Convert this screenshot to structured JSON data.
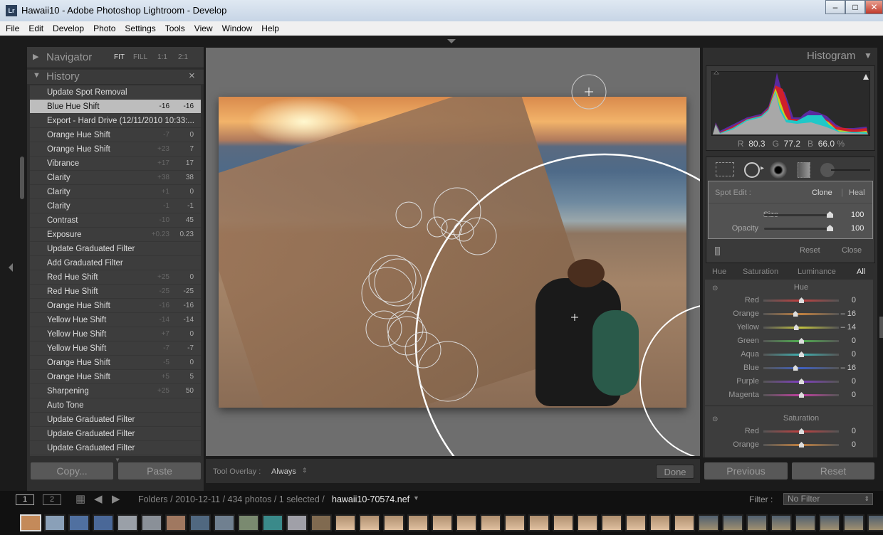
{
  "window": {
    "title": "Hawaii10 - Adobe Photoshop Lightroom - Develop",
    "app_icon": "Lr",
    "minimize": "–",
    "maximize": "□",
    "close": "✕"
  },
  "menu": [
    "File",
    "Edit",
    "Develop",
    "Photo",
    "Settings",
    "Tools",
    "View",
    "Window",
    "Help"
  ],
  "navigator": {
    "title": "Navigator",
    "zooms": [
      "FIT",
      "FILL",
      "1:1",
      "2:1"
    ]
  },
  "history": {
    "title": "History",
    "close": "×",
    "items": [
      {
        "label": "Update Spot Removal",
        "delta": "",
        "value": ""
      },
      {
        "label": "Blue Hue Shift",
        "delta": "-16",
        "value": "-16",
        "selected": true
      },
      {
        "label": "Export - Hard Drive (12/11/2010 10:33:...",
        "delta": "",
        "value": ""
      },
      {
        "label": "Orange Hue Shift",
        "delta": "-7",
        "value": "0"
      },
      {
        "label": "Orange Hue Shift",
        "delta": "+23",
        "value": "7"
      },
      {
        "label": "Vibrance",
        "delta": "+17",
        "value": "17"
      },
      {
        "label": "Clarity",
        "delta": "+38",
        "value": "38"
      },
      {
        "label": "Clarity",
        "delta": "+1",
        "value": "0"
      },
      {
        "label": "Clarity",
        "delta": "-1",
        "value": "-1"
      },
      {
        "label": "Contrast",
        "delta": "-10",
        "value": "45"
      },
      {
        "label": "Exposure",
        "delta": "+0.23",
        "value": "0.23"
      },
      {
        "label": "Update Graduated Filter",
        "delta": "",
        "value": ""
      },
      {
        "label": "Add Graduated Filter",
        "delta": "",
        "value": ""
      },
      {
        "label": "Red Hue Shift",
        "delta": "+25",
        "value": "0"
      },
      {
        "label": "Red Hue Shift",
        "delta": "-25",
        "value": "-25"
      },
      {
        "label": "Orange Hue Shift",
        "delta": "-16",
        "value": "-16"
      },
      {
        "label": "Yellow Hue Shift",
        "delta": "-14",
        "value": "-14"
      },
      {
        "label": "Yellow Hue Shift",
        "delta": "+7",
        "value": "0"
      },
      {
        "label": "Yellow Hue Shift",
        "delta": "-7",
        "value": "-7"
      },
      {
        "label": "Orange Hue Shift",
        "delta": "-5",
        "value": "0"
      },
      {
        "label": "Orange Hue Shift",
        "delta": "+5",
        "value": "5"
      },
      {
        "label": "Sharpening",
        "delta": "+25",
        "value": "50"
      },
      {
        "label": "Auto Tone",
        "delta": "",
        "value": ""
      },
      {
        "label": "Update Graduated Filter",
        "delta": "",
        "value": ""
      },
      {
        "label": "Update Graduated Filter",
        "delta": "",
        "value": ""
      },
      {
        "label": "Update Graduated Filter",
        "delta": "",
        "value": ""
      }
    ]
  },
  "left_buttons": {
    "copy": "Copy...",
    "paste": "Paste"
  },
  "toolbar": {
    "overlay_label": "Tool Overlay :",
    "overlay_value": "Always",
    "done": "Done"
  },
  "histogram": {
    "title": "Histogram",
    "r_label": "R",
    "r": "80.3",
    "g_label": "G",
    "g": "77.2",
    "b_label": "B",
    "b": "66.0",
    "unit": "%"
  },
  "spot": {
    "label": "Spot Edit :",
    "clone": "Clone",
    "heal": "Heal",
    "size_label": "Size",
    "size": "100",
    "size_level": 100,
    "opacity_label": "Opacity",
    "opacity": "100",
    "opacity_level": 100,
    "reset": "Reset",
    "close": "Close"
  },
  "hsl": {
    "tabs": [
      "Hue",
      "Saturation",
      "Luminance",
      "All"
    ],
    "active_tab": "All",
    "hue_title": "Hue",
    "hue": [
      {
        "label": "Red",
        "value": "0",
        "color": "#c04040"
      },
      {
        "label": "Orange",
        "value": "– 16",
        "color": "#c08040"
      },
      {
        "label": "Yellow",
        "value": "– 14",
        "color": "#c0c040"
      },
      {
        "label": "Green",
        "value": "0",
        "color": "#50b050"
      },
      {
        "label": "Aqua",
        "value": "0",
        "color": "#40b0b0"
      },
      {
        "label": "Blue",
        "value": "– 16",
        "color": "#4060c0"
      },
      {
        "label": "Purple",
        "value": "0",
        "color": "#8040c0"
      },
      {
        "label": "Magenta",
        "value": "0",
        "color": "#c040a0"
      }
    ],
    "sat_title": "Saturation",
    "sat": [
      {
        "label": "Red",
        "value": "0",
        "color": "#c04040"
      },
      {
        "label": "Orange",
        "value": "0",
        "color": "#c08040"
      }
    ]
  },
  "right_buttons": {
    "previous": "Previous",
    "reset": "Reset"
  },
  "filmstrip": {
    "view1": "1",
    "view2": "2",
    "breadcrumb": "Folders / 2010-12-11 / 434 photos / 1 selected /",
    "filename": "hawaii10-70574.nef",
    "filter_label": "Filter :",
    "filter_value": "No Filter"
  }
}
